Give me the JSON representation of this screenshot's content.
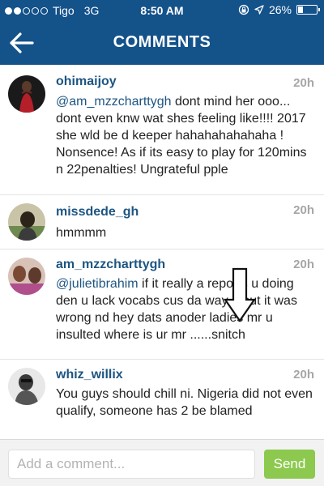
{
  "status_bar": {
    "carrier": "Tigo",
    "network": "3G",
    "time": "8:50 AM",
    "battery": "26%",
    "signal_level": 0.4,
    "battery_level": 0.26
  },
  "nav": {
    "title": "COMMENTS",
    "back_icon": "arrow-left-icon"
  },
  "comments": [
    {
      "username": "ohimaijoy",
      "time": "20h",
      "mention": "@am_mzzcharttygh",
      "text": " dont mind her ooo... dont even knw wat shes feeling like!!!! 2017 she wld be d keeper hahahahahahaha ! Nonsence! As if its easy to play for 120mins n 22penalties! Ungrateful pple"
    },
    {
      "username": "missdede_gh",
      "time": "20h",
      "mention": "",
      "text": "hmmmm"
    },
    {
      "username": "am_mzzcharttygh",
      "time": "20h",
      "mention": "@julietibrahim",
      "text": " if it really a reports u doing den u lack vocabs cus da way u put it was wrong nd hey dats  anoder ladies mr u insulted where is ur mr ......snitch"
    },
    {
      "username": "whiz_willix",
      "time": "20h",
      "mention": "",
      "text": "You guys should chill ni. Nigeria did not even qualify, someone has 2 be blamed"
    }
  ],
  "composer": {
    "placeholder": "Add a comment...",
    "value": "",
    "send_label": "Send"
  },
  "colors": {
    "header": "#14528a",
    "username": "#1d5582",
    "timestamp": "#a6a6a6",
    "send_button": "#8cc94e"
  }
}
